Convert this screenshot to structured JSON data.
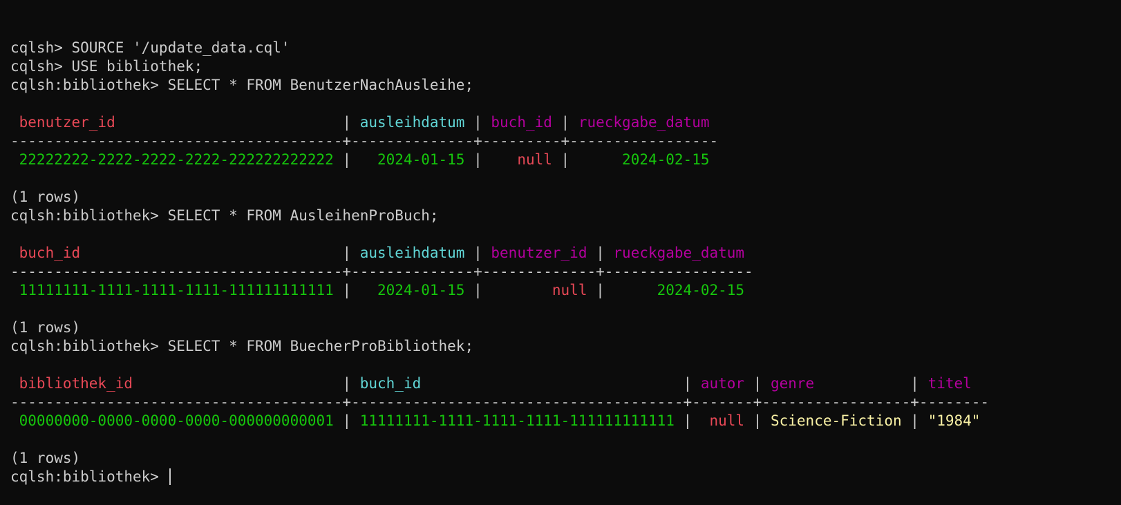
{
  "colors": {
    "background": "#0c0c0c",
    "text": "#cccccc",
    "red": "#e74856",
    "cyan": "#61d6d6",
    "magenta": "#b4009e",
    "green": "#16c60c",
    "yellow": "#f9f1a5"
  },
  "lines": [
    {
      "type": "text",
      "name": "prompt-line",
      "segments": [
        {
          "text": "cqlsh> SOURCE '/update_data.cql'",
          "color": "white"
        }
      ]
    },
    {
      "type": "text",
      "name": "prompt-line",
      "segments": [
        {
          "text": "cqlsh> USE bibliothek;",
          "color": "white"
        }
      ]
    },
    {
      "type": "text",
      "name": "prompt-line",
      "segments": [
        {
          "text": "cqlsh:bibliothek> SELECT * FROM BenutzerNachAusleihe;",
          "color": "white"
        }
      ]
    },
    {
      "type": "blank"
    },
    {
      "type": "text",
      "name": "table-header-row",
      "segments": [
        {
          "text": " benutzer_id                          ",
          "color": "red"
        },
        {
          "text": "| ",
          "color": "white"
        },
        {
          "text": "ausleihdatum",
          "color": "cyan"
        },
        {
          "text": " | ",
          "color": "white"
        },
        {
          "text": "buch_id",
          "color": "magenta"
        },
        {
          "text": " | ",
          "color": "white"
        },
        {
          "text": "rueckgabe_datum",
          "color": "magenta"
        }
      ]
    },
    {
      "type": "text",
      "name": "table-separator",
      "segments": [
        {
          "text": "--------------------------------------+--------------+---------+-----------------",
          "color": "white"
        }
      ]
    },
    {
      "type": "text",
      "name": "table-row",
      "segments": [
        {
          "text": " 22222222-2222-2222-2222-222222222222",
          "color": "green"
        },
        {
          "text": " |   ",
          "color": "white"
        },
        {
          "text": "2024-01-15",
          "color": "green"
        },
        {
          "text": " |    ",
          "color": "white"
        },
        {
          "text": "null",
          "color": "red"
        },
        {
          "text": " |      ",
          "color": "white"
        },
        {
          "text": "2024-02-15",
          "color": "green"
        }
      ]
    },
    {
      "type": "blank"
    },
    {
      "type": "text",
      "name": "row-count",
      "segments": [
        {
          "text": "(1 rows)",
          "color": "white"
        }
      ]
    },
    {
      "type": "text",
      "name": "prompt-line",
      "segments": [
        {
          "text": "cqlsh:bibliothek> SELECT * FROM AusleihenProBuch;",
          "color": "white"
        }
      ]
    },
    {
      "type": "blank"
    },
    {
      "type": "text",
      "name": "table-header-row",
      "segments": [
        {
          "text": " buch_id                              ",
          "color": "red"
        },
        {
          "text": "| ",
          "color": "white"
        },
        {
          "text": "ausleihdatum",
          "color": "cyan"
        },
        {
          "text": " | ",
          "color": "white"
        },
        {
          "text": "benutzer_id",
          "color": "magenta"
        },
        {
          "text": " | ",
          "color": "white"
        },
        {
          "text": "rueckgabe_datum",
          "color": "magenta"
        }
      ]
    },
    {
      "type": "text",
      "name": "table-separator",
      "segments": [
        {
          "text": "--------------------------------------+--------------+-------------+-----------------",
          "color": "white"
        }
      ]
    },
    {
      "type": "text",
      "name": "table-row",
      "segments": [
        {
          "text": " 11111111-1111-1111-1111-111111111111",
          "color": "green"
        },
        {
          "text": " |   ",
          "color": "white"
        },
        {
          "text": "2024-01-15",
          "color": "green"
        },
        {
          "text": " |        ",
          "color": "white"
        },
        {
          "text": "null",
          "color": "red"
        },
        {
          "text": " |      ",
          "color": "white"
        },
        {
          "text": "2024-02-15",
          "color": "green"
        }
      ]
    },
    {
      "type": "blank"
    },
    {
      "type": "text",
      "name": "row-count",
      "segments": [
        {
          "text": "(1 rows)",
          "color": "white"
        }
      ]
    },
    {
      "type": "text",
      "name": "prompt-line",
      "segments": [
        {
          "text": "cqlsh:bibliothek> SELECT * FROM BuecherProBibliothek;",
          "color": "white"
        }
      ]
    },
    {
      "type": "blank"
    },
    {
      "type": "text",
      "name": "table-header-row",
      "segments": [
        {
          "text": " bibliothek_id                        ",
          "color": "red"
        },
        {
          "text": "| ",
          "color": "white"
        },
        {
          "text": "buch_id                             ",
          "color": "cyan"
        },
        {
          "text": " | ",
          "color": "white"
        },
        {
          "text": "autor",
          "color": "magenta"
        },
        {
          "text": " | ",
          "color": "white"
        },
        {
          "text": "genre          ",
          "color": "magenta"
        },
        {
          "text": " | ",
          "color": "white"
        },
        {
          "text": "titel",
          "color": "magenta"
        }
      ]
    },
    {
      "type": "text",
      "name": "table-separator",
      "segments": [
        {
          "text": "--------------------------------------+--------------------------------------+-------+-----------------+--------",
          "color": "white"
        }
      ]
    },
    {
      "type": "text",
      "name": "table-row",
      "segments": [
        {
          "text": " 00000000-0000-0000-0000-000000000001",
          "color": "green"
        },
        {
          "text": " | ",
          "color": "white"
        },
        {
          "text": "11111111-1111-1111-1111-111111111111",
          "color": "green"
        },
        {
          "text": " |  ",
          "color": "white"
        },
        {
          "text": "null",
          "color": "red"
        },
        {
          "text": " | ",
          "color": "white"
        },
        {
          "text": "Science-Fiction",
          "color": "yellow"
        },
        {
          "text": " | ",
          "color": "white"
        },
        {
          "text": "\"1984\"",
          "color": "yellow"
        }
      ]
    },
    {
      "type": "blank"
    },
    {
      "type": "text",
      "name": "row-count",
      "segments": [
        {
          "text": "(1 rows)",
          "color": "white"
        }
      ]
    },
    {
      "type": "prompt",
      "name": "active-prompt",
      "segments": [
        {
          "text": "cqlsh:bibliothek> ",
          "color": "white"
        }
      ]
    }
  ]
}
